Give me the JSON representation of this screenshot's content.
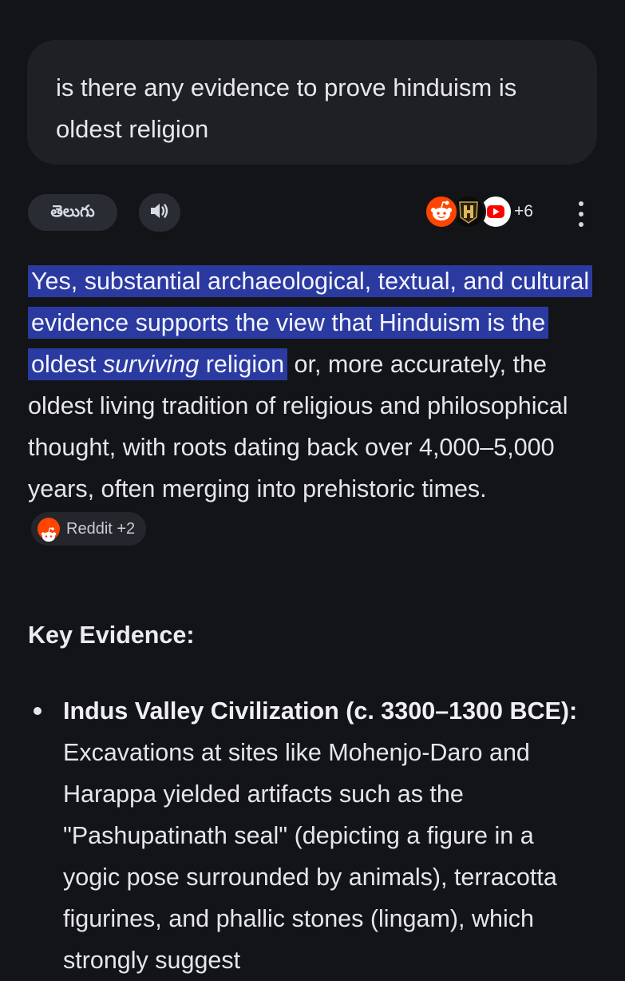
{
  "query": {
    "text": "is there any evidence to prove hinduism is oldest religion"
  },
  "toolbar": {
    "language_label": "తెలుగు",
    "speaker_icon": "speaker-icon",
    "sources": {
      "icons": [
        "reddit-icon",
        "history-channel-icon",
        "youtube-icon"
      ],
      "count_label": "+6"
    },
    "more_icon": "more-vertical-icon"
  },
  "answer": {
    "highlight_part1": "Yes, substantial archaeological, textual, and cultural evidence supports the view that Hinduism is the oldest ",
    "highlight_emphasis": "surviving",
    "highlight_part2": " religion",
    "rest": " or, more accurately, the oldest living tradition of religious and philosophical thought, with roots dating back over 4,000–5,000 years, often merging into prehistoric times.",
    "citation_label": "Reddit +2"
  },
  "section": {
    "title": "Key Evidence:"
  },
  "evidence": [
    {
      "title": "Indus Valley Civilization (c. 3300–1300 BCE):",
      "text": " Excavations at sites like Mohenjo-Daro and Harappa yielded artifacts such as the \"Pashupatinath seal\" (depicting a figure in a yogic pose surrounded by animals), terracotta figurines, and phallic stones (lingam), which strongly suggest"
    }
  ],
  "colors": {
    "background": "#131418",
    "bubble": "#1f2024",
    "chip": "#2a2c33",
    "highlight": "#2b3aa0",
    "reddit": "#ff4500"
  }
}
